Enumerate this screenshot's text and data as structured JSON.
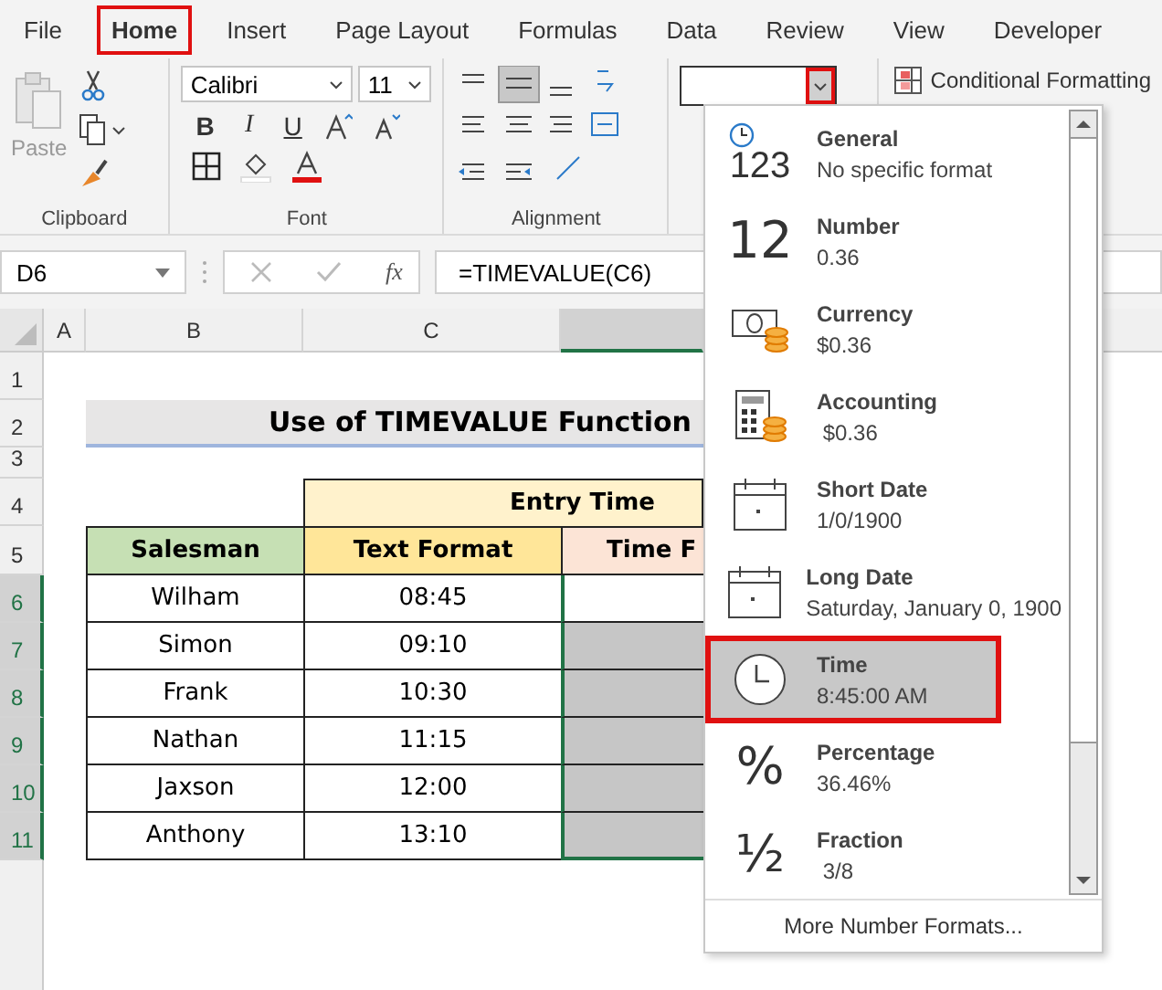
{
  "menu_tabs": [
    {
      "label": "File",
      "selected": false,
      "annotated": false
    },
    {
      "label": "Home",
      "selected": true,
      "annotated": true
    },
    {
      "label": "Insert",
      "selected": false,
      "annotated": false
    },
    {
      "label": "Page Layout",
      "selected": false,
      "annotated": false
    },
    {
      "label": "Formulas",
      "selected": false,
      "annotated": false
    },
    {
      "label": "Data",
      "selected": false,
      "annotated": false
    },
    {
      "label": "Review",
      "selected": false,
      "annotated": false
    },
    {
      "label": "View",
      "selected": false,
      "annotated": false
    },
    {
      "label": "Developer",
      "selected": false,
      "annotated": false
    }
  ],
  "ribbon": {
    "clipboard": {
      "paste": "Paste",
      "group_label": "Clipboard"
    },
    "font": {
      "name": "Calibri",
      "size": "11",
      "bold": "B",
      "italic": "I",
      "underline": "U",
      "group_label": "Font"
    },
    "alignment": {
      "group_label": "Alignment"
    },
    "number_format": {
      "dropdown_annotated": true
    },
    "conditional_formatting": "Conditional Formatting"
  },
  "formula_bar": {
    "name_box": "D6",
    "fx": "fx",
    "formula": "=TIMEVALUE(C6)"
  },
  "sheet": {
    "columns": [
      {
        "label": "A",
        "selected": false
      },
      {
        "label": "B",
        "selected": false
      },
      {
        "label": "C",
        "selected": false
      }
    ],
    "row_numbers": [
      {
        "label": "1",
        "selected": false
      },
      {
        "label": "2",
        "selected": false
      },
      {
        "label": "3",
        "selected": false
      },
      {
        "label": "4",
        "selected": false
      },
      {
        "label": "5",
        "selected": false
      },
      {
        "label": "6",
        "selected": true
      },
      {
        "label": "7",
        "selected": true
      },
      {
        "label": "8",
        "selected": true
      },
      {
        "label": "9",
        "selected": true
      },
      {
        "label": "10",
        "selected": true
      },
      {
        "label": "11",
        "selected": true
      }
    ],
    "title": "Use of TIMEVALUE Function",
    "group_header": "Entry Time",
    "headers": [
      "Salesman",
      "Text Format",
      "Time F"
    ],
    "rows": [
      {
        "salesman": "Wilham",
        "text": "08:45",
        "selected": false
      },
      {
        "salesman": "Simon",
        "text": "09:10",
        "selected": true
      },
      {
        "salesman": "Frank",
        "text": "10:30",
        "selected": true
      },
      {
        "salesman": "Nathan",
        "text": "11:15",
        "selected": true
      },
      {
        "salesman": "Jaxson",
        "text": "12:00",
        "selected": true
      },
      {
        "salesman": "Anthony",
        "text": "13:10",
        "selected": true
      }
    ]
  },
  "format_menu": {
    "items": [
      {
        "kind": "general",
        "glyph": "123",
        "name": "General",
        "example": "No specific format",
        "selected": false,
        "annotated": false
      },
      {
        "kind": "number",
        "glyph": "12",
        "name": "Number",
        "example": "0.36",
        "selected": false,
        "annotated": false
      },
      {
        "kind": "currency",
        "name": "Currency",
        "example": "$0.36",
        "selected": false,
        "annotated": false
      },
      {
        "kind": "accounting",
        "name": "Accounting",
        "example": " $0.36",
        "selected": false,
        "annotated": false
      },
      {
        "kind": "date",
        "name": "Short Date",
        "example": "1/0/1900",
        "selected": false,
        "annotated": false
      },
      {
        "kind": "date",
        "name": "Long Date",
        "example": "Saturday, January 0, 1900",
        "selected": false,
        "annotated": false
      },
      {
        "kind": "time",
        "name": "Time",
        "example": "8:45:00 AM",
        "selected": true,
        "annotated": true
      },
      {
        "kind": "percentage",
        "glyph": "%",
        "name": "Percentage",
        "example": "36.46%",
        "selected": false,
        "annotated": false
      },
      {
        "kind": "fraction",
        "glyph": "½",
        "name": "Fraction",
        "example": " 3/8",
        "selected": false,
        "annotated": false
      }
    ],
    "more": "More Number Formats..."
  }
}
